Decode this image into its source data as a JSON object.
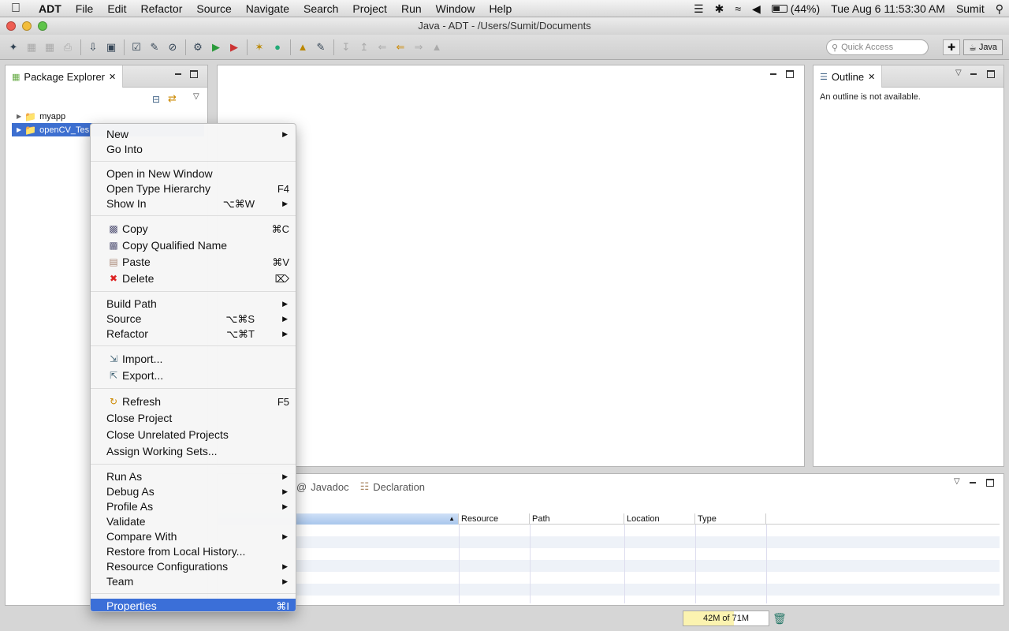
{
  "menubar": {
    "app": "ADT",
    "items": [
      "File",
      "Edit",
      "Refactor",
      "Source",
      "Navigate",
      "Search",
      "Project",
      "Run",
      "Window",
      "Help"
    ],
    "battery": "(44%)",
    "clock": "Tue Aug 6  11:53:30 AM",
    "user": "Sumit"
  },
  "window": {
    "title": "Java - ADT - /Users/Sumit/Documents"
  },
  "toolbar": {
    "quick_access_placeholder": "Quick Access",
    "perspective": "Java"
  },
  "package_explorer": {
    "title": "Package Explorer",
    "items": [
      {
        "label": "myapp"
      },
      {
        "label": "openCV_Tes"
      }
    ]
  },
  "outline": {
    "title": "Outline",
    "message": "An outline is not available."
  },
  "bottom_panel": {
    "tabs": [
      "Javadoc",
      "Declaration"
    ],
    "columns": [
      "Resource",
      "Path",
      "Location",
      "Type"
    ]
  },
  "status": {
    "heap": "42M of 71M",
    "heap_used_fraction": 0.59
  },
  "context_menu": {
    "groups": [
      [
        {
          "label": "New",
          "submenu": true
        },
        {
          "label": "Go Into"
        }
      ],
      [
        {
          "label": "Open in New Window"
        },
        {
          "label": "Open Type Hierarchy",
          "shortcut": "F4"
        },
        {
          "label": "Show In",
          "shortcut": "⌥⌘W",
          "submenu": true
        }
      ],
      [
        {
          "label": "Copy",
          "shortcut": "⌘C",
          "icon": "copy-icon"
        },
        {
          "label": "Copy Qualified Name",
          "icon": "copy-qualified-icon"
        },
        {
          "label": "Paste",
          "shortcut": "⌘V",
          "icon": "paste-icon"
        },
        {
          "label": "Delete",
          "shortcut": "⌦",
          "icon": "delete-icon"
        }
      ],
      [
        {
          "label": "Build Path",
          "submenu": true
        },
        {
          "label": "Source",
          "shortcut": "⌥⌘S",
          "submenu": true
        },
        {
          "label": "Refactor",
          "shortcut": "⌥⌘T",
          "submenu": true
        }
      ],
      [
        {
          "label": "Import...",
          "icon": "import-icon"
        },
        {
          "label": "Export...",
          "icon": "export-icon"
        }
      ],
      [
        {
          "label": "Refresh",
          "shortcut": "F5",
          "icon": "refresh-icon"
        },
        {
          "label": "Close Project"
        },
        {
          "label": "Close Unrelated Projects"
        },
        {
          "label": "Assign Working Sets..."
        }
      ],
      [
        {
          "label": "Run As",
          "submenu": true
        },
        {
          "label": "Debug As",
          "submenu": true
        },
        {
          "label": "Profile As",
          "submenu": true
        },
        {
          "label": "Validate"
        },
        {
          "label": "Compare With",
          "submenu": true
        },
        {
          "label": "Restore from Local History..."
        },
        {
          "label": "Resource Configurations",
          "submenu": true
        },
        {
          "label": "Team",
          "submenu": true
        }
      ],
      [
        {
          "label": "Properties",
          "shortcut": "⌘I",
          "highlighted": true
        }
      ]
    ]
  }
}
